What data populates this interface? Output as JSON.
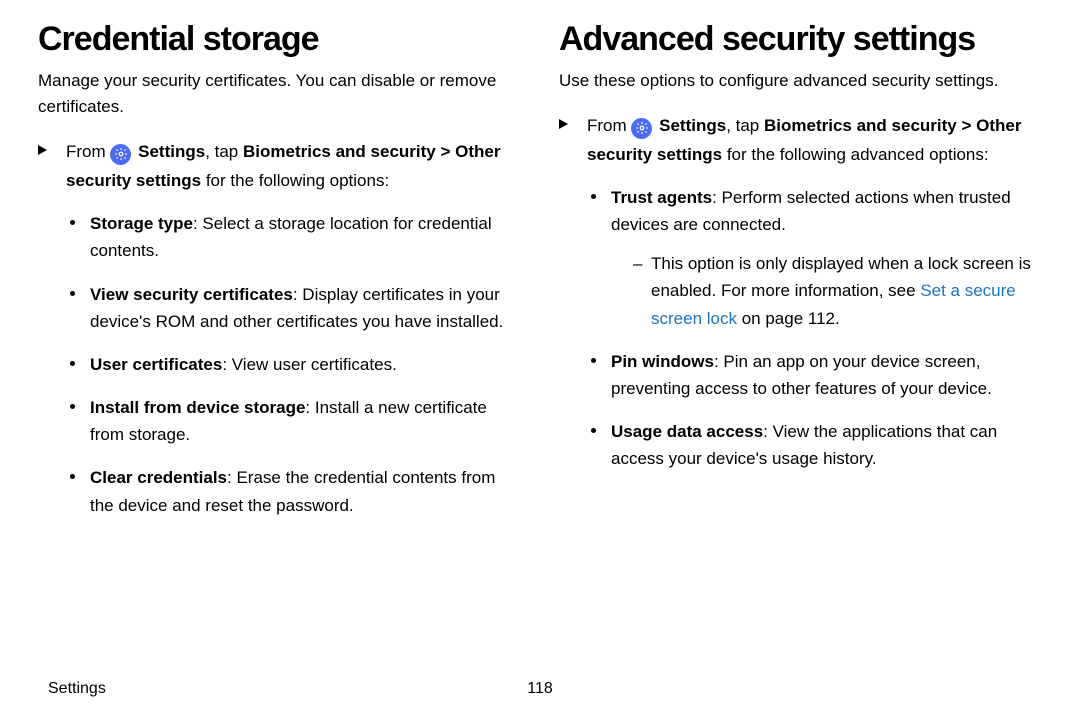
{
  "left": {
    "heading": "Credential storage",
    "intro": "Manage your security certificates. You can disable or remove certificates.",
    "step_prefix": "From ",
    "step_settings": "Settings",
    "step_mid": ", tap ",
    "step_path1": "Biometrics and security",
    "step_path2": "Other security settings",
    "step_suffix": " for the following options:",
    "items": [
      {
        "title": "Storage type",
        "desc": ": Select a storage location for credential contents."
      },
      {
        "title": "View security certificates",
        "desc": ": Display certificates in your device's ROM and other certificates you have installed."
      },
      {
        "title": "User certificates",
        "desc": ": View user certificates."
      },
      {
        "title": "Install from device storage",
        "desc": ": Install a new certificate from storage."
      },
      {
        "title": "Clear credentials",
        "desc": ": Erase the credential contents from the device and reset the password."
      }
    ]
  },
  "right": {
    "heading": "Advanced security settings",
    "intro": "Use these options to configure advanced security settings.",
    "step_prefix": "From ",
    "step_settings": "Settings",
    "step_mid": ", tap ",
    "step_path1": "Biometrics and security",
    "step_path2": "Other security settings",
    "step_suffix": " for the following advanced options:",
    "items": [
      {
        "title": "Trust agents",
        "desc": ": Perform selected actions when trusted devices are connected.",
        "sub_pre": "This option is only displayed when a lock screen is enabled. For more information, see ",
        "sub_link": "Set a secure screen lock",
        "sub_post": " on page 112."
      },
      {
        "title": "Pin windows",
        "desc": ": Pin an app on your device screen, preventing access to other features of your device."
      },
      {
        "title": "Usage data access",
        "desc": ": View the applications that can access your device's usage history."
      }
    ]
  },
  "footer": {
    "section": "Settings",
    "page": "118"
  },
  "chevron": ">"
}
